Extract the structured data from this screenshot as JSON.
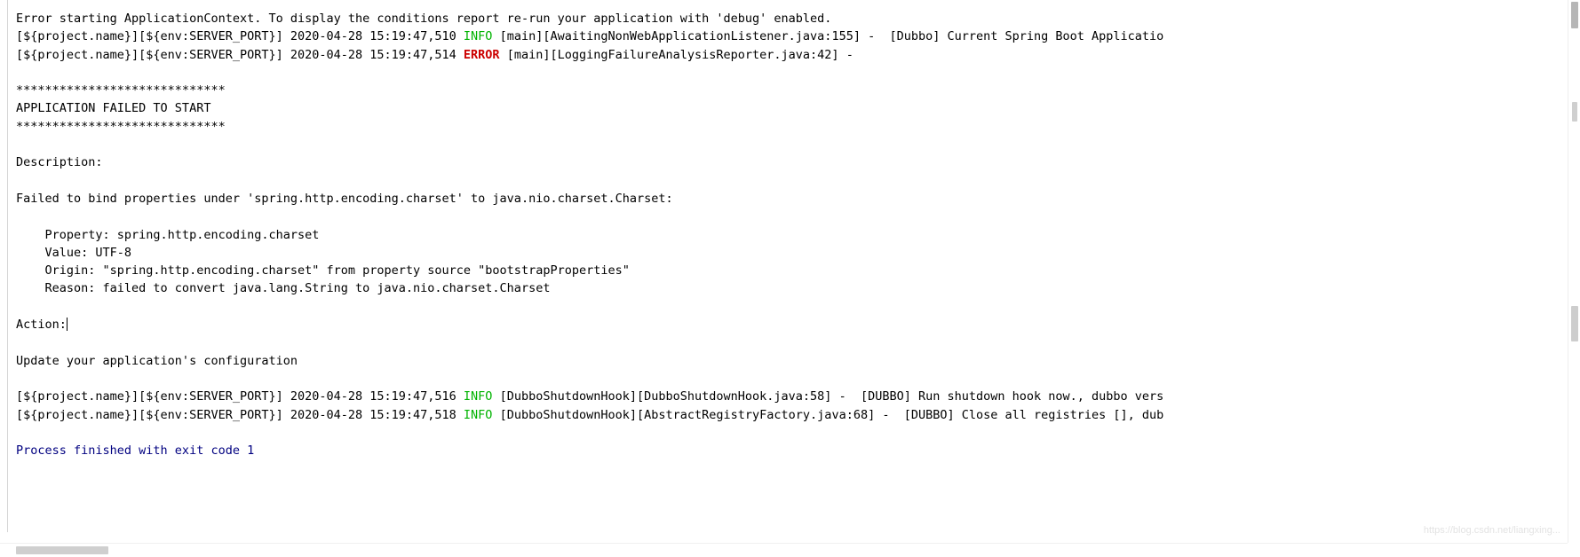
{
  "console": {
    "title": "Run console output",
    "lines": [
      {
        "id": "line-app-context-error",
        "segments": [
          {
            "text": "Error starting ApplicationContext. To display the conditions report re-run your application with 'debug' enabled.",
            "style": "default"
          }
        ]
      },
      {
        "id": "line-info-awaiting-listener",
        "segments": [
          {
            "text": "[${project.name}][${env:SERVER_PORT}] 2020-04-28 15:19:47,510 ",
            "style": "default"
          },
          {
            "text": "INFO",
            "style": "info"
          },
          {
            "text": " [main][AwaitingNonWebApplicationListener.java:155] -  [Dubbo] Current Spring Boot Applicatio",
            "style": "default"
          }
        ]
      },
      {
        "id": "line-error-failure-reporter",
        "segments": [
          {
            "text": "[${project.name}][${env:SERVER_PORT}] 2020-04-28 15:19:47,514 ",
            "style": "default"
          },
          {
            "text": "ERROR",
            "style": "error"
          },
          {
            "text": " [main][LoggingFailureAnalysisReporter.java:42] -",
            "style": "default"
          }
        ]
      },
      {
        "id": "line-blank-1",
        "segments": [
          {
            "text": "",
            "style": "default"
          }
        ]
      },
      {
        "id": "line-banner-top",
        "segments": [
          {
            "text": "*****************************",
            "style": "default"
          }
        ]
      },
      {
        "id": "line-banner-title",
        "segments": [
          {
            "text": "APPLICATION FAILED TO START",
            "style": "default"
          }
        ]
      },
      {
        "id": "line-banner-bottom",
        "segments": [
          {
            "text": "*****************************",
            "style": "default"
          }
        ]
      },
      {
        "id": "line-blank-2",
        "segments": [
          {
            "text": "",
            "style": "default"
          }
        ]
      },
      {
        "id": "line-description-label",
        "segments": [
          {
            "text": "Description:",
            "style": "default"
          }
        ]
      },
      {
        "id": "line-blank-3",
        "segments": [
          {
            "text": "",
            "style": "default"
          }
        ]
      },
      {
        "id": "line-failed-to-bind",
        "segments": [
          {
            "text": "Failed to bind properties under 'spring.http.encoding.charset' to java.nio.charset.Charset:",
            "style": "default"
          }
        ]
      },
      {
        "id": "line-blank-4",
        "segments": [
          {
            "text": "",
            "style": "default"
          }
        ]
      },
      {
        "id": "line-property",
        "segments": [
          {
            "text": "    Property: spring.http.encoding.charset",
            "style": "default"
          }
        ]
      },
      {
        "id": "line-value",
        "segments": [
          {
            "text": "    Value: UTF-8",
            "style": "default"
          }
        ]
      },
      {
        "id": "line-origin",
        "segments": [
          {
            "text": "    Origin: \"spring.http.encoding.charset\" from property source \"bootstrapProperties\"",
            "style": "default"
          }
        ]
      },
      {
        "id": "line-reason",
        "segments": [
          {
            "text": "    Reason: failed to convert java.lang.String to java.nio.charset.Charset",
            "style": "default"
          }
        ]
      },
      {
        "id": "line-blank-5",
        "segments": [
          {
            "text": "",
            "style": "default"
          }
        ]
      },
      {
        "id": "line-action-label",
        "segments": [
          {
            "text": "Action:",
            "style": "default"
          }
        ],
        "caret": true
      },
      {
        "id": "line-blank-6",
        "segments": [
          {
            "text": "",
            "style": "default"
          }
        ]
      },
      {
        "id": "line-action-body",
        "segments": [
          {
            "text": "Update your application's configuration",
            "style": "default"
          }
        ]
      },
      {
        "id": "line-blank-7",
        "segments": [
          {
            "text": "",
            "style": "default"
          }
        ]
      },
      {
        "id": "line-info-shutdown-hook",
        "segments": [
          {
            "text": "[${project.name}][${env:SERVER_PORT}] 2020-04-28 15:19:47,516 ",
            "style": "default"
          },
          {
            "text": "INFO",
            "style": "info"
          },
          {
            "text": " [DubboShutdownHook][DubboShutdownHook.java:58] -  [DUBBO] Run shutdown hook now., dubbo vers",
            "style": "default"
          }
        ]
      },
      {
        "id": "line-info-close-registries",
        "segments": [
          {
            "text": "[${project.name}][${env:SERVER_PORT}] 2020-04-28 15:19:47,518 ",
            "style": "default"
          },
          {
            "text": "INFO",
            "style": "info"
          },
          {
            "text": " [DubboShutdownHook][AbstractRegistryFactory.java:68] -  [DUBBO] Close all registries [], dub",
            "style": "default"
          }
        ]
      },
      {
        "id": "line-blank-8",
        "segments": [
          {
            "text": "",
            "style": "default"
          }
        ]
      },
      {
        "id": "line-process-finished",
        "segments": [
          {
            "text": "Process finished with exit code 1",
            "style": "exit"
          }
        ]
      }
    ]
  },
  "watermark": {
    "text": "https://blog.csdn.net/liangxing..."
  },
  "colors": {
    "background": "#ffffff",
    "text": "#000000",
    "info": "#00b300",
    "error": "#cc0000",
    "exit_code": "#000080",
    "scrollbar_thumb": "#cfcfcf",
    "watermark": "#e3e3e3"
  },
  "scrollbars": {
    "vertical_name": "vertical-scrollbar",
    "horizontal_name": "horizontal-scrollbar"
  }
}
